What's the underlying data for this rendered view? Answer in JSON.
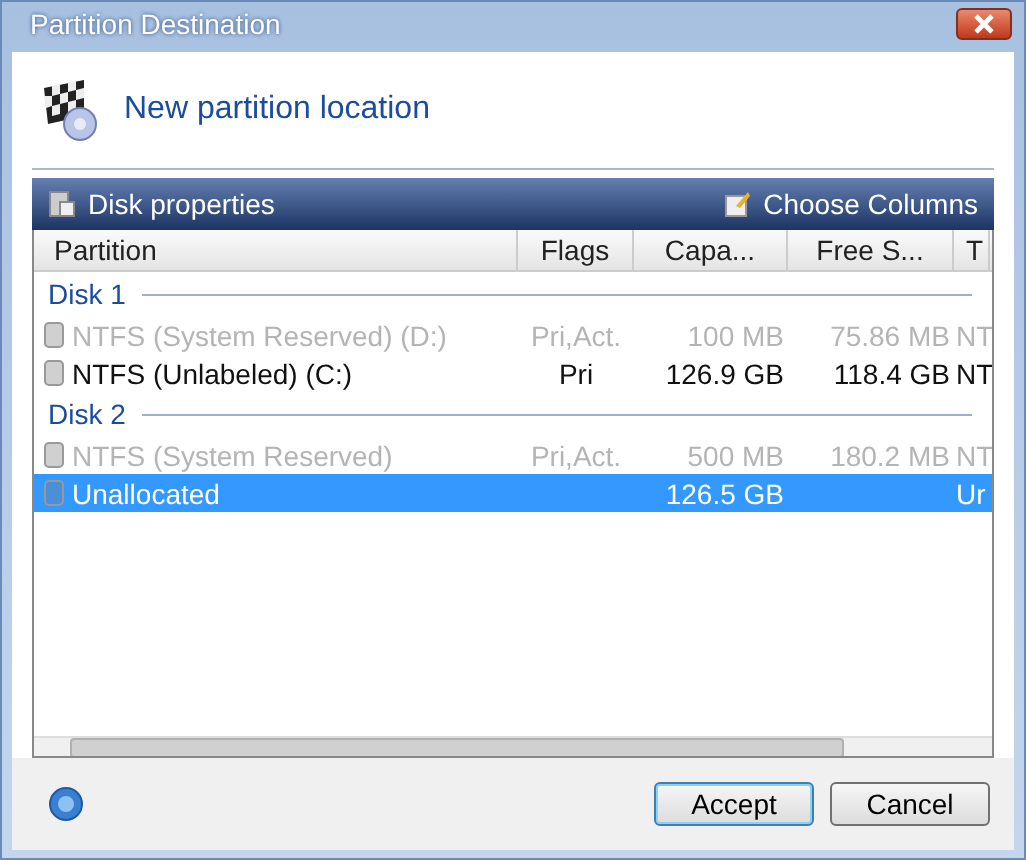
{
  "window": {
    "title": "Partition Destination"
  },
  "header": {
    "title": "New partition location"
  },
  "toolbar": {
    "left": "Disk properties",
    "right": "Choose Columns"
  },
  "table": {
    "columns": [
      "Partition",
      "Flags",
      "Capa...",
      "Free S...",
      "T"
    ],
    "rows": [
      {
        "kind": "group",
        "label": "Disk 1"
      },
      {
        "kind": "partition",
        "cells": [
          "NTFS (System Reserved) (D:)",
          "Pri,Act.",
          "100 MB",
          "75.86 MB",
          "NT"
        ],
        "disabled": true,
        "selected": false
      },
      {
        "kind": "partition",
        "cells": [
          "NTFS (Unlabeled) (C:)",
          "Pri",
          "126.9 GB",
          "118.4 GB",
          "NT"
        ],
        "disabled": false,
        "selected": false
      },
      {
        "kind": "group",
        "label": "Disk 2"
      },
      {
        "kind": "partition",
        "cells": [
          "NTFS (System Reserved)",
          "Pri,Act.",
          "500 MB",
          "180.2 MB",
          "NT"
        ],
        "disabled": true,
        "selected": false
      },
      {
        "kind": "partition",
        "cells": [
          "Unallocated",
          "",
          "126.5 GB",
          "",
          "Ur"
        ],
        "disabled": false,
        "selected": true
      }
    ]
  },
  "buttons": [
    "Accept",
    "Cancel"
  ]
}
